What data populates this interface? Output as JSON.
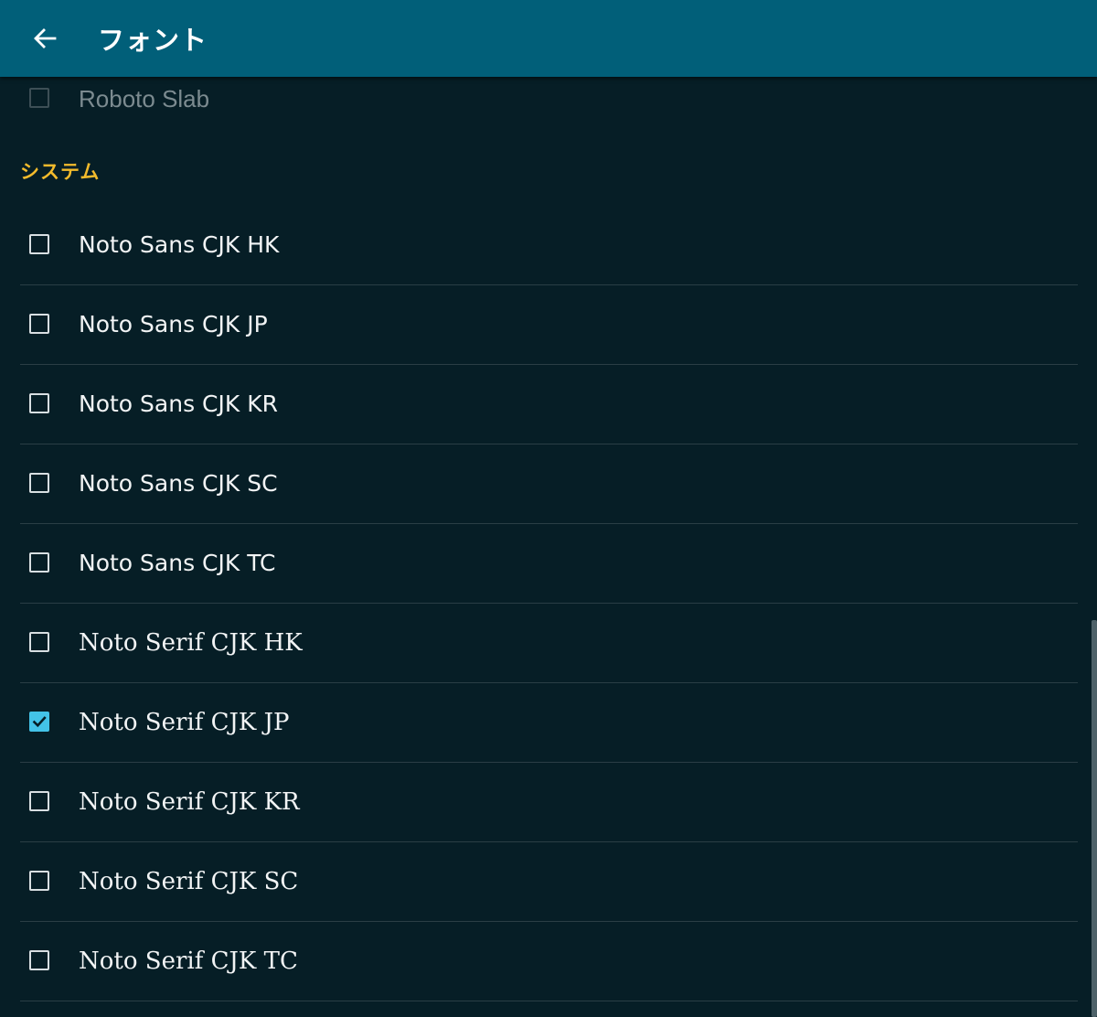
{
  "appbar": {
    "title": "フォント",
    "back_icon": "arrow-left-icon",
    "background": "#015f79"
  },
  "partial_item": {
    "label": "Roboto Slab",
    "checked": false
  },
  "section": {
    "header": "システム",
    "header_color": "#f3bb2c"
  },
  "fonts": [
    {
      "label": "Noto Sans CJK HK",
      "style": "sans",
      "checked": false
    },
    {
      "label": "Noto Sans CJK JP",
      "style": "sans",
      "checked": false
    },
    {
      "label": "Noto Sans CJK KR",
      "style": "sans",
      "checked": false
    },
    {
      "label": "Noto Sans CJK SC",
      "style": "sans",
      "checked": false
    },
    {
      "label": "Noto Sans CJK TC",
      "style": "sans",
      "checked": false
    },
    {
      "label": "Noto Serif CJK HK",
      "style": "serif",
      "checked": false
    },
    {
      "label": "Noto Serif CJK JP",
      "style": "serif",
      "checked": true
    },
    {
      "label": "Noto Serif CJK KR",
      "style": "serif",
      "checked": false
    },
    {
      "label": "Noto Serif CJK SC",
      "style": "serif",
      "checked": false
    },
    {
      "label": "Noto Serif CJK TC",
      "style": "serif",
      "checked": false
    }
  ],
  "colors": {
    "background": "#061e26",
    "checkbox_checked": "#43c3e8",
    "divider": "#2a3e45"
  }
}
